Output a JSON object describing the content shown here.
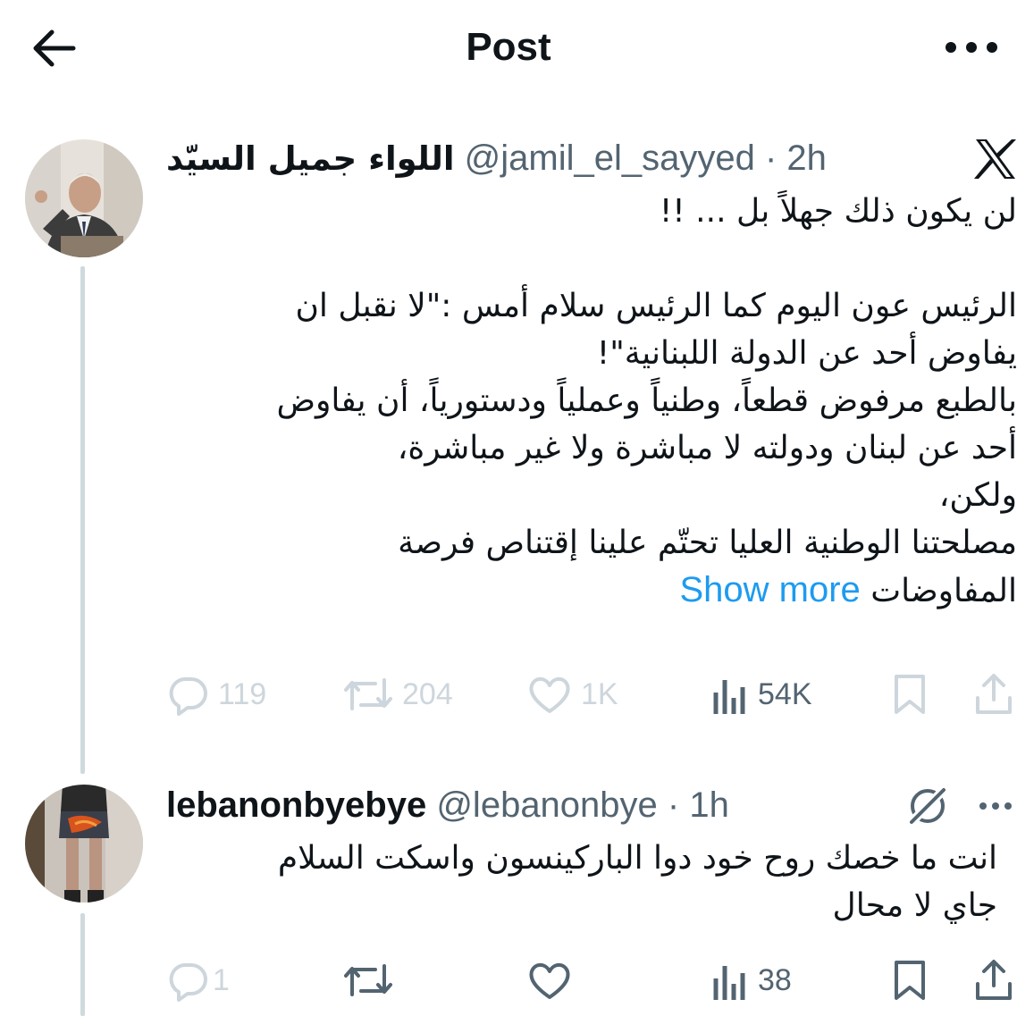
{
  "header": {
    "title": "Post"
  },
  "main_post": {
    "display_name": "اللواء جميل السيّد",
    "handle": "@jamil_el_sayyed",
    "time": "2h",
    "text_lines": [
      "لن يكون ذلك جهلاً بل ... !!",
      "",
      "الرئيس عون اليوم كما الرئيس سلام أمس :\"لا نقبل ان",
      "يفاوض أحد عن الدولة اللبنانية\"!",
      "بالطبع مرفوض قطعاً، وطنياً وعملياً ودستورياً، أن يفاوض",
      "أحد عن لبنان ودولته لا مباشرة ولا غير مباشرة،",
      "ولكن،",
      "مصلحتنا الوطنية العليا تحتّم علينا إقتناص فرصة"
    ],
    "last_line": "المفاوضات",
    "show_more": "Show more",
    "stats": {
      "replies": "119",
      "reposts": "204",
      "likes": "1K",
      "views": "54K"
    }
  },
  "reply_post": {
    "display_name": "lebanonbyebye",
    "handle": "@lebanonbye",
    "time": "1h",
    "text_lines": [
      "انت ما خصك روح خود دوا الباركينسون واسكت السلام",
      "جاي لا محال"
    ],
    "stats": {
      "replies": "1",
      "views": "38"
    }
  },
  "icons": {
    "back": "arrow-left-icon",
    "more": "more-horizontal-icon",
    "x_logo": "x-logo-icon",
    "reply": "reply-icon",
    "repost": "repost-icon",
    "like": "heart-icon",
    "views": "analytics-icon",
    "bookmark": "bookmark-icon",
    "share": "share-icon",
    "grok": "grok-icon"
  },
  "colors": {
    "link": "#1d9bf0",
    "text": "#0f1419",
    "secondary": "#536471",
    "disabled": "#cdd6dc",
    "thread_line": "#cfd9de"
  }
}
